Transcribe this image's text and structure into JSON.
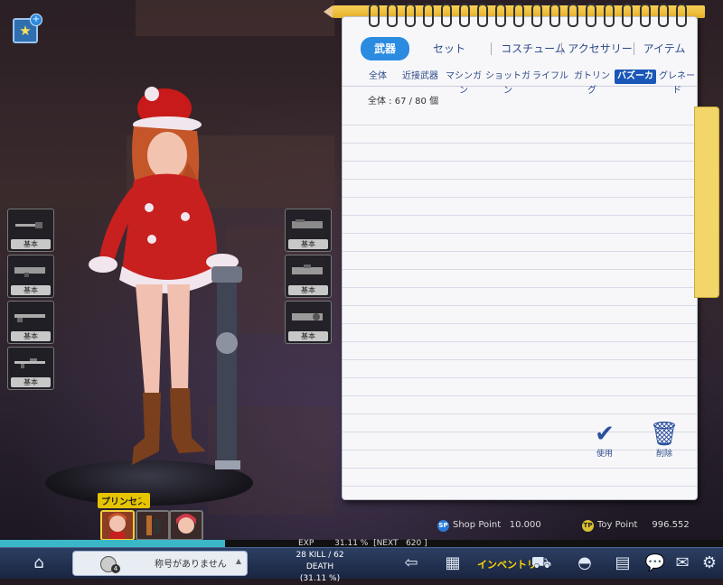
{
  "main_tabs": [
    {
      "label": "武器",
      "active": true
    },
    {
      "label": "セット",
      "active": false
    },
    {
      "label": "コスチューム",
      "active": false
    },
    {
      "label": "アクセサリー",
      "active": false
    },
    {
      "label": "アイテム",
      "active": false
    }
  ],
  "sub_tabs": [
    {
      "label": "全体",
      "active": false
    },
    {
      "label": "近接武器",
      "active": false
    },
    {
      "label": "マシンガン",
      "active": false
    },
    {
      "label": "ショットガン",
      "active": false
    },
    {
      "label": "ライフル",
      "active": false
    },
    {
      "label": "ガトリング",
      "active": false
    },
    {
      "label": "バズーカ",
      "active": true
    },
    {
      "label": "グレネード",
      "active": false
    }
  ],
  "inventory_count": "全体 : 67 / 80 個",
  "actions": {
    "use_label": "使用",
    "delete_label": "削除"
  },
  "weapon_slots_left": [
    {
      "label": "基本",
      "icon": "knife-icon"
    },
    {
      "label": "基本",
      "icon": "bazooka-icon"
    },
    {
      "label": "基本",
      "icon": "shotgun-icon"
    },
    {
      "label": "基本",
      "icon": "rifle-icon"
    }
  ],
  "weapon_slots_right": [
    {
      "label": "基本",
      "icon": "gatling-icon"
    },
    {
      "label": "基本",
      "icon": "launcher-icon"
    },
    {
      "label": "基本",
      "icon": "grenade-launcher-icon"
    }
  ],
  "character": {
    "name_tag": "プリンセス"
  },
  "currency": {
    "shop_point_badge": "SP",
    "shop_point_label": "Shop Point",
    "shop_point_value": "10.000",
    "toy_point_badge": "TP",
    "toy_point_label": "Toy Point",
    "toy_point_value": "996.552"
  },
  "status": {
    "exp_text": "EXP        31.11 %  [NEXT   620 ]",
    "exp_progress": 0.3111,
    "title_text": "称号がありません",
    "level": "4",
    "kill_death": "28 KILL / 62 DEATH",
    "kd_ratio": "(31.11 %)",
    "inventory_label": "インベントリ"
  },
  "colors": {
    "accent": "#2a8be0",
    "active_subtab": "#1a57b8",
    "name_tag": "#e7c400"
  }
}
